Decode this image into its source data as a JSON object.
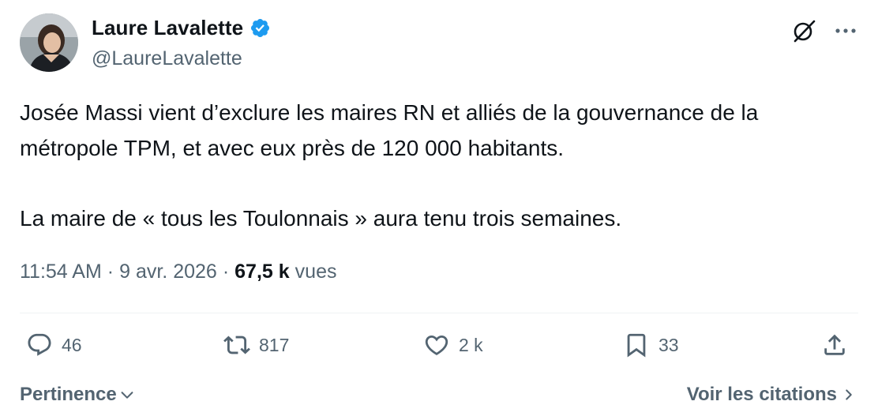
{
  "author": {
    "display_name": "Laure Lavalette",
    "handle": "@LaureLavalette",
    "verified": true
  },
  "icons": {
    "verified": "verified-badge-icon",
    "grok": "grok-icon",
    "more": "more-icon"
  },
  "tweet": {
    "paragraphs": [
      "Josée Massi vient d’exclure les maires RN et alliés de la gouvernance de la métropole TPM, et avec eux près de 120 000 habitants.",
      "La maire de « tous les Toulonnais » aura tenu trois semaines."
    ]
  },
  "meta": {
    "time": "11:54 AM",
    "separator": "·",
    "date": "9 avr. 2026",
    "views_count": "67,5 k",
    "views_label": "vues"
  },
  "actions": {
    "replies": "46",
    "reposts": "817",
    "likes": "2 k",
    "bookmarks": "33"
  },
  "footer": {
    "sort_label": "Pertinence",
    "quotes_label": "Voir les citations"
  },
  "colors": {
    "text_primary": "#0f1419",
    "text_secondary": "#536471",
    "verified_blue": "#1d9bf0",
    "divider": "#eff3f4"
  }
}
